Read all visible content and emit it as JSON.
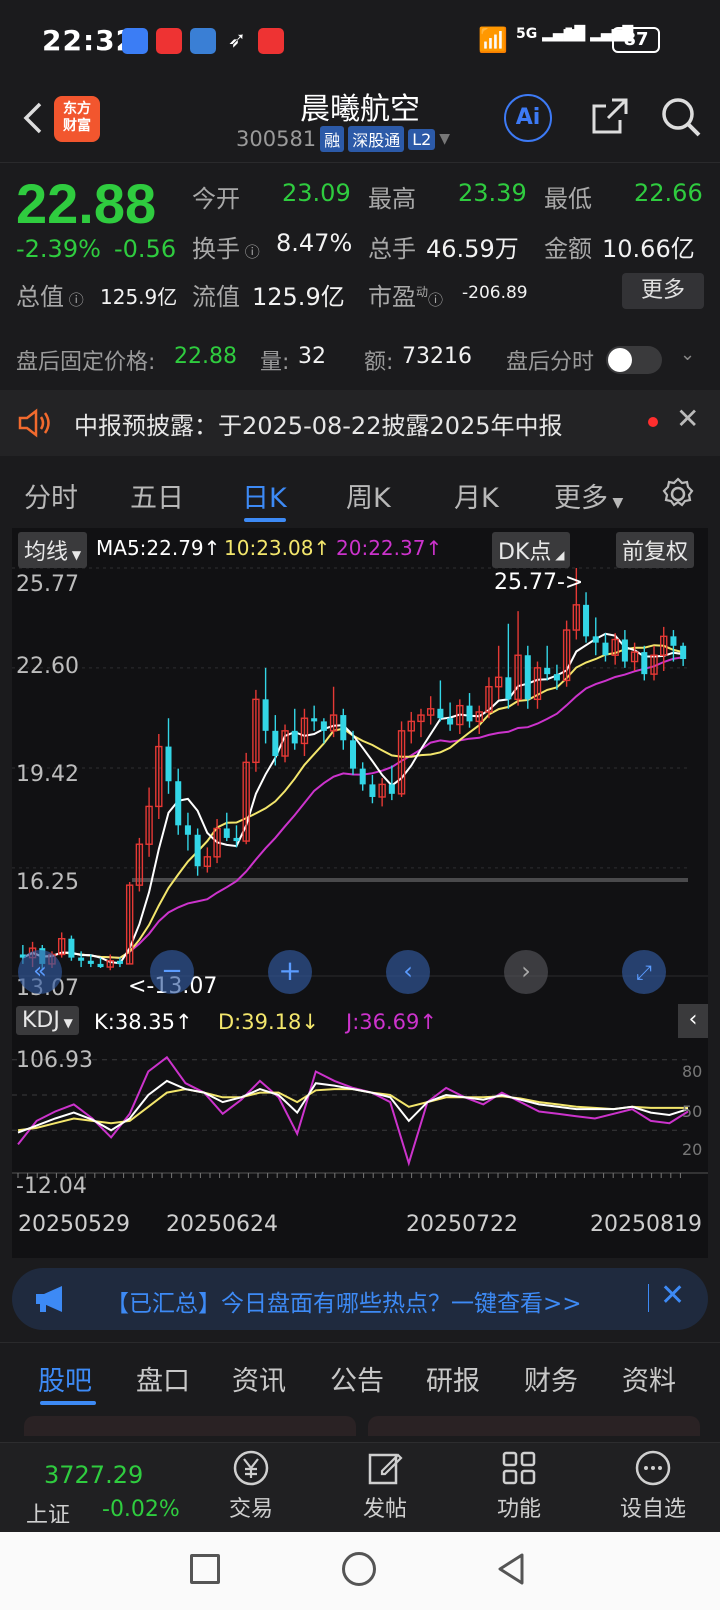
{
  "status_bar": {
    "time": "22:32",
    "battery": "87",
    "signal_1": "5G",
    "signal_2": "5G"
  },
  "header": {
    "logo_line1": "东方",
    "logo_line2": "财富",
    "stock_name": "晨曦航空",
    "stock_code": "300581",
    "tags": [
      "融",
      "深股通",
      "L2"
    ],
    "ai_label": "Ai"
  },
  "quote": {
    "price": "22.88",
    "change_pct": "-2.39%",
    "change_abs": "-0.56",
    "open_label": "今开",
    "open": "23.09",
    "high_label": "最高",
    "high": "23.39",
    "low_label": "最低",
    "low": "22.66",
    "turnover_label": "换手",
    "turnover": "8.47%",
    "volume_label": "总手",
    "volume": "46.59万",
    "amount_label": "金额",
    "amount": "10.66亿",
    "mktcap_label": "总值",
    "mktcap": "125.9亿",
    "float_label": "流值",
    "float": "125.9亿",
    "pe_label": "市盈",
    "pe_sup": "动",
    "pe": "-206.89",
    "more_label": "更多"
  },
  "after_hours": {
    "price_label": "盘后固定价格:",
    "price": "22.88",
    "vol_label": "量:",
    "vol": "32",
    "amt_label": "额:",
    "amt": "73216",
    "toggle_label": "盘后分时"
  },
  "notice": {
    "text": "中报预披露：于2025-08-22披露2025年中报"
  },
  "kline_tabs": [
    "分时",
    "五日",
    "日K",
    "周K",
    "月K",
    "更多"
  ],
  "chart": {
    "ma_chip": "均线",
    "ma5": "MA5:22.79↑",
    "ma10": "10:23.08↑",
    "ma20": "20:22.37↑",
    "dk_chip": "DK点",
    "adjust_chip": "前复权",
    "price_ticks": [
      "25.77",
      "22.60",
      "19.42",
      "16.25",
      "13.07"
    ],
    "high_marker": "25.77->",
    "low_marker": "<-13.07",
    "kdj_chip": "KDJ",
    "kdj_k": "K:38.35↑",
    "kdj_d": "D:39.18↓",
    "kdj_j": "J:36.69↑",
    "kdj_top": "106.93",
    "kdj_bottom": "-12.04",
    "kdj_levels": [
      "80",
      "50",
      "20"
    ],
    "dates": [
      "20250529",
      "20250624",
      "20250722",
      "20250819"
    ],
    "colors": {
      "up": "#e53935",
      "down": "#33d6e6",
      "ma5": "#ffffff",
      "ma10": "#f3e66c",
      "ma20": "#cc33cc"
    }
  },
  "chart_data": {
    "type": "candlestick",
    "ohlc": [
      [
        13.5,
        13.8,
        13.2,
        13.4
      ],
      [
        13.4,
        13.9,
        13.1,
        13.7
      ],
      [
        13.7,
        13.8,
        13.0,
        13.2
      ],
      [
        13.2,
        13.6,
        13.07,
        13.5
      ],
      [
        13.5,
        14.2,
        13.4,
        14.0
      ],
      [
        14.0,
        14.1,
        13.3,
        13.4
      ],
      [
        13.4,
        13.6,
        13.1,
        13.3
      ],
      [
        13.3,
        13.5,
        13.1,
        13.2
      ],
      [
        13.2,
        13.4,
        13.07,
        13.1
      ],
      [
        13.1,
        13.5,
        13.0,
        13.3
      ],
      [
        13.3,
        13.4,
        13.1,
        13.2
      ],
      [
        13.2,
        15.8,
        13.2,
        15.7
      ],
      [
        15.7,
        17.2,
        15.5,
        17.0
      ],
      [
        17.0,
        18.8,
        16.6,
        18.2
      ],
      [
        18.2,
        20.5,
        17.8,
        20.1
      ],
      [
        20.1,
        21.0,
        18.6,
        19.0
      ],
      [
        19.0,
        19.4,
        17.3,
        17.6
      ],
      [
        17.6,
        18.0,
        16.8,
        17.3
      ],
      [
        17.3,
        17.5,
        16.0,
        16.3
      ],
      [
        16.3,
        16.9,
        16.1,
        16.6
      ],
      [
        16.6,
        17.8,
        16.4,
        17.5
      ],
      [
        17.5,
        18.0,
        17.1,
        17.2
      ],
      [
        17.2,
        17.6,
        16.9,
        17.1
      ],
      [
        17.1,
        19.9,
        17.0,
        19.6
      ],
      [
        19.6,
        21.9,
        19.3,
        21.6
      ],
      [
        21.6,
        22.6,
        20.2,
        20.6
      ],
      [
        20.6,
        21.1,
        19.5,
        19.8
      ],
      [
        19.8,
        20.8,
        19.6,
        20.6
      ],
      [
        20.6,
        21.3,
        20.0,
        20.2
      ],
      [
        20.2,
        21.3,
        19.8,
        21.0
      ],
      [
        21.0,
        21.4,
        20.6,
        20.9
      ],
      [
        20.9,
        21.0,
        20.2,
        20.6
      ],
      [
        20.6,
        22.0,
        20.4,
        21.1
      ],
      [
        21.1,
        21.3,
        20.0,
        20.3
      ],
      [
        20.3,
        20.6,
        19.2,
        19.4
      ],
      [
        19.4,
        19.6,
        18.7,
        18.9
      ],
      [
        18.9,
        19.2,
        18.3,
        18.5
      ],
      [
        18.5,
        19.1,
        18.2,
        18.9
      ],
      [
        18.9,
        19.5,
        18.4,
        18.6
      ],
      [
        18.6,
        20.9,
        18.5,
        20.6
      ],
      [
        20.6,
        21.2,
        20.2,
        20.9
      ],
      [
        20.9,
        21.3,
        20.4,
        21.1
      ],
      [
        21.1,
        21.7,
        20.8,
        21.3
      ],
      [
        21.3,
        22.2,
        20.9,
        21.0
      ],
      [
        21.0,
        21.5,
        20.6,
        20.8
      ],
      [
        20.8,
        21.6,
        20.5,
        21.4
      ],
      [
        21.4,
        21.8,
        20.7,
        20.9
      ],
      [
        20.9,
        21.4,
        20.5,
        21.2
      ],
      [
        21.2,
        22.3,
        21.0,
        22.0
      ],
      [
        22.0,
        23.3,
        21.6,
        22.3
      ],
      [
        22.3,
        24.0,
        21.3,
        21.6
      ],
      [
        21.6,
        24.4,
        21.4,
        23.0
      ],
      [
        23.0,
        23.3,
        21.3,
        21.6
      ],
      [
        21.6,
        22.8,
        21.3,
        22.6
      ],
      [
        22.6,
        23.3,
        22.2,
        22.4
      ],
      [
        22.4,
        22.7,
        21.9,
        22.2
      ],
      [
        22.2,
        24.1,
        22.0,
        23.8
      ],
      [
        23.8,
        25.77,
        23.5,
        24.6
      ],
      [
        24.6,
        25.0,
        23.4,
        23.6
      ],
      [
        23.6,
        24.2,
        23.0,
        23.4
      ],
      [
        23.4,
        23.7,
        22.8,
        23.0
      ],
      [
        23.0,
        23.7,
        22.7,
        23.5
      ],
      [
        23.5,
        23.8,
        22.6,
        22.8
      ],
      [
        22.8,
        23.4,
        22.5,
        23.1
      ],
      [
        23.1,
        23.3,
        22.2,
        22.4
      ],
      [
        22.4,
        23.3,
        22.2,
        23.0
      ],
      [
        23.0,
        23.9,
        22.5,
        23.6
      ],
      [
        23.6,
        23.8,
        22.8,
        23.3
      ],
      [
        23.3,
        23.4,
        22.66,
        22.88
      ]
    ],
    "kdj": {
      "K": [
        18,
        24,
        30,
        35,
        29,
        20,
        30,
        50,
        62,
        55,
        52,
        44,
        48,
        55,
        50,
        35,
        60,
        58,
        55,
        52,
        48,
        28,
        44,
        50,
        48,
        46,
        50,
        46,
        42,
        40,
        38,
        38,
        38,
        40,
        35,
        33,
        38
      ],
      "D": [
        20,
        22,
        26,
        30,
        28,
        26,
        28,
        40,
        52,
        55,
        52,
        48,
        48,
        52,
        52,
        44,
        54,
        55,
        55,
        52,
        50,
        40,
        44,
        48,
        48,
        48,
        49,
        47,
        44,
        42,
        40,
        39,
        38,
        40,
        39,
        39,
        39
      ],
      "J": [
        8,
        28,
        36,
        42,
        30,
        14,
        34,
        70,
        82,
        60,
        52,
        34,
        46,
        62,
        48,
        17,
        70,
        62,
        56,
        52,
        44,
        -8,
        44,
        56,
        48,
        42,
        52,
        44,
        36,
        34,
        32,
        30,
        34,
        38,
        28,
        26,
        36
      ]
    }
  },
  "promo": {
    "text": "【已汇总】今日盘面有哪些热点？一键查看>>"
  },
  "bottom_tabs": [
    "股吧",
    "盘口",
    "资讯",
    "公告",
    "研报",
    "财务",
    "资料"
  ],
  "footer": {
    "index_value": "3727.29",
    "index_name": "上证",
    "index_change": "-0.02%",
    "trade": "交易",
    "post": "发帖",
    "func": "功能",
    "watch": "设自选"
  }
}
